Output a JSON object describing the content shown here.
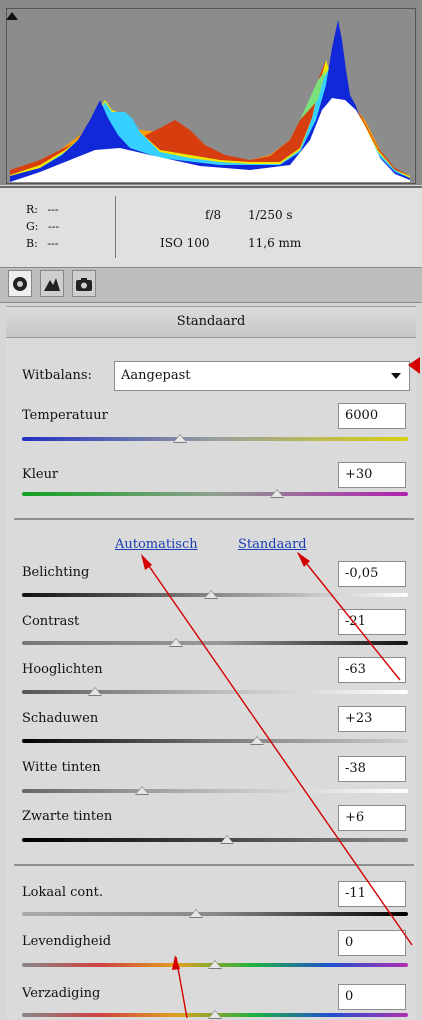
{
  "info": {
    "r_label": "R:",
    "r_value": "---",
    "g_label": "G:",
    "g_value": "---",
    "b_label": "B:",
    "b_value": "---",
    "aperture": "f/8",
    "shutter": "1/250 s",
    "iso": "ISO 100",
    "focal": "11,6 mm"
  },
  "panel_title": "Standaard",
  "whitebalance": {
    "label": "Witbalans:",
    "value": "Aangepast"
  },
  "links": {
    "auto": "Automatisch",
    "default": "Standaard"
  },
  "sliders": [
    {
      "label": "Temperatuur",
      "value": "6000",
      "position": 0.41
    },
    {
      "label": "Kleur",
      "value": "+30",
      "position": 0.66
    },
    {
      "label": "Belichting",
      "value": "-0,05",
      "position": 0.49
    },
    {
      "label": "Contrast",
      "value": "-21",
      "position": 0.4
    },
    {
      "label": "Hooglichten",
      "value": "-63",
      "position": 0.19
    },
    {
      "label": "Schaduwen",
      "value": "+23",
      "position": 0.61
    },
    {
      "label": "Witte tinten",
      "value": "-38",
      "position": 0.31
    },
    {
      "label": "Zwarte tinten",
      "value": "+6",
      "position": 0.53
    },
    {
      "label": "Lokaal cont.",
      "value": "-11",
      "position": 0.45
    },
    {
      "label": "Levendigheid",
      "value": "0",
      "position": 0.5
    },
    {
      "label": "Verzadiging",
      "value": "0",
      "position": 0.5
    }
  ],
  "colors": {
    "annotation": "#d40000",
    "link": "#1a3db0"
  }
}
